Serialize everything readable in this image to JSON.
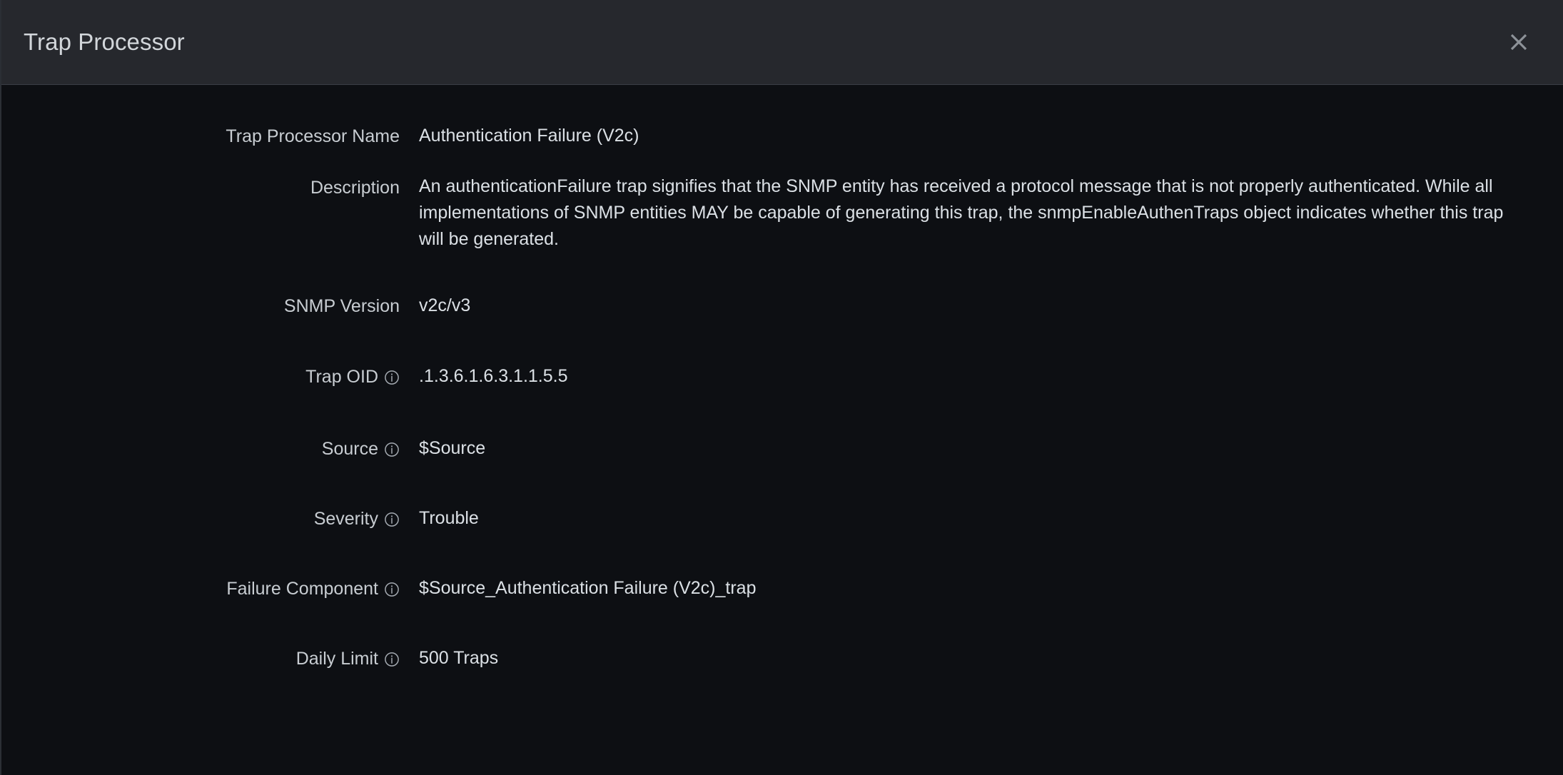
{
  "dialog": {
    "title": "Trap Processor",
    "close_label": "×",
    "close_icon": "close-icon"
  },
  "info_icon_name": "info-icon",
  "fields": [
    {
      "id": "trap-processor-name",
      "label": "Trap Processor Name",
      "value": "Authentication Failure (V2c)",
      "has_info": false
    },
    {
      "id": "description",
      "label": "Description",
      "value": "An authenticationFailure trap signifies that the SNMP entity has received a protocol message that is not properly authenticated. While all implementations of SNMP entities MAY be capable of generating this trap, the snmpEnableAuthenTraps object indicates whether this trap will be generated.",
      "has_info": false
    },
    {
      "id": "snmp-version",
      "label": "SNMP Version",
      "value": "v2c/v3",
      "has_info": false
    },
    {
      "id": "trap-oid",
      "label": "Trap OID",
      "value": ".1.3.6.1.6.3.1.1.5.5",
      "has_info": true
    },
    {
      "id": "source",
      "label": "Source",
      "value": "$Source",
      "has_info": true
    },
    {
      "id": "severity",
      "label": "Severity",
      "value": "Trouble",
      "has_info": true
    },
    {
      "id": "failure-component",
      "label": "Failure Component",
      "value": "$Source_Authentication Failure (V2c)_trap",
      "has_info": true
    },
    {
      "id": "daily-limit",
      "label": "Daily Limit",
      "value": "500 Traps",
      "has_info": true
    }
  ],
  "colors": {
    "header_background": "#26282d",
    "body_background": "#0d0f13",
    "label_text": "#c8cdd2",
    "value_text": "#dbe0e5",
    "title_text": "#d2d6da",
    "icon_stroke": "#9ba1a8",
    "divider": "#3a3e45"
  }
}
